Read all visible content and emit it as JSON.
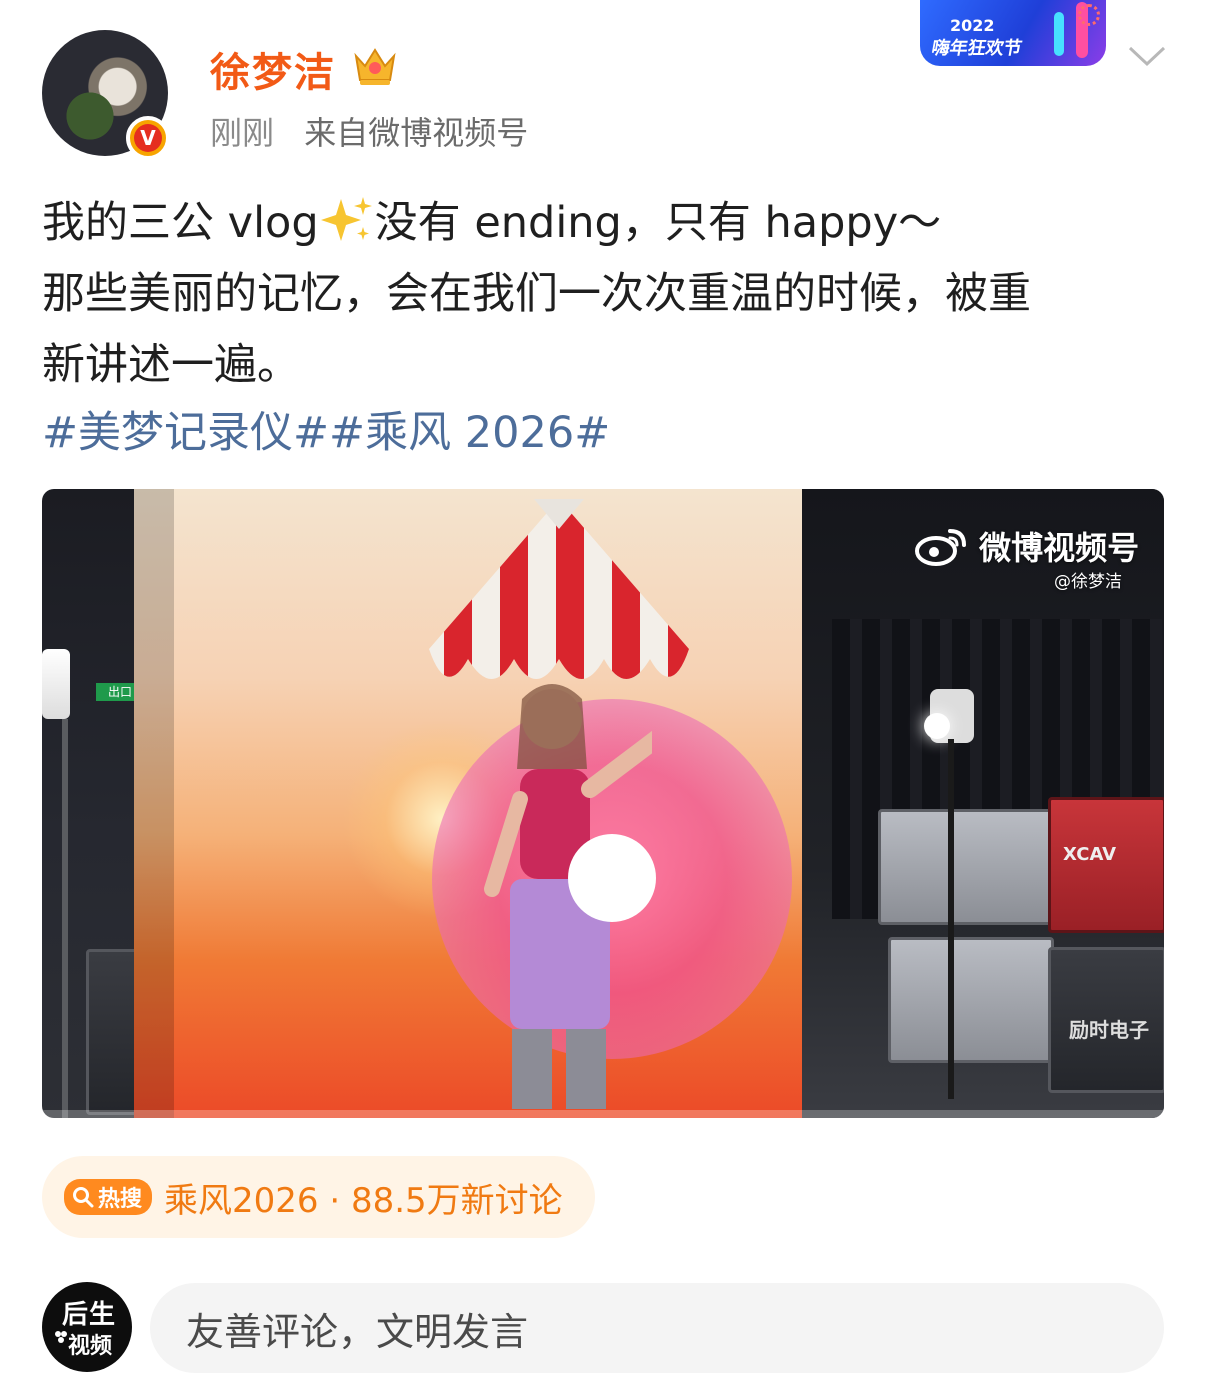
{
  "post": {
    "author": {
      "name": "徐梦洁",
      "verified": true
    },
    "time": "刚刚",
    "source": "来自微博视频号",
    "event_badge": {
      "year": "2022",
      "text": "嗨年狂欢节"
    },
    "text_lines": [
      "我的三公 vlog",
      "没有 ending，只有 happy～",
      "那些美丽的记忆，会在我们一次次重温的时候，被重",
      "新讲述一遍。"
    ],
    "hashtags": "#美梦记录仪##乘风 2026#",
    "video": {
      "watermark_label": "微博视频号",
      "watermark_handle": "@徐梦洁",
      "exit_sign": "出口",
      "case_brand": "XCAV",
      "case_label": "励时电子"
    },
    "trend": {
      "tag": "热搜",
      "text": "乘风2026 · 88.5万新讨论"
    }
  },
  "footer": {
    "logo_line1": "后生",
    "logo_line2": "视频",
    "comment_placeholder": "友善评论，文明发言"
  },
  "colors": {
    "username": "#f25a16",
    "hashtag": "#4d6d9a",
    "trend_text": "#f07a12",
    "trend_bg": "#fff4e6"
  }
}
